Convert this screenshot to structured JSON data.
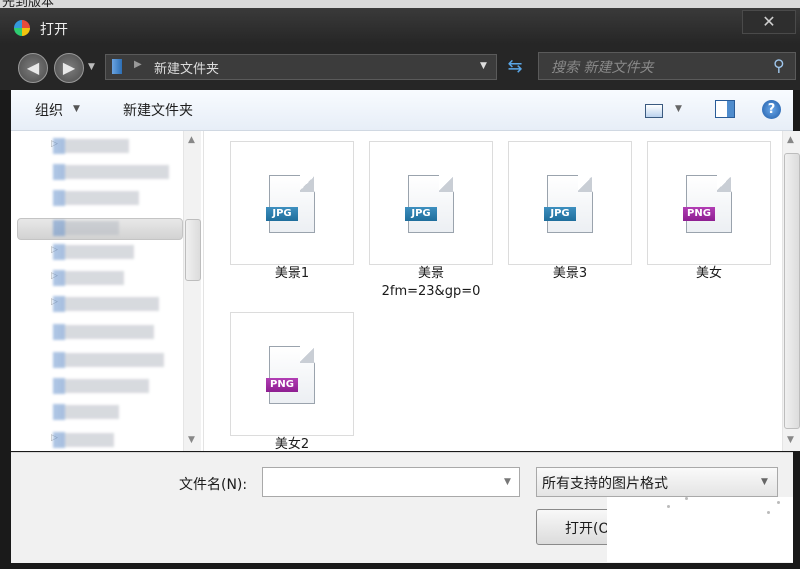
{
  "window": {
    "title": "打开",
    "close_glyph": "✕"
  },
  "nav": {
    "back_glyph": "◀",
    "forward_glyph": "▶",
    "address": {
      "path": "新建文件夹"
    },
    "search": {
      "placeholder": "搜索 新建文件夹"
    }
  },
  "toolbar": {
    "organize_label": "组织",
    "new_folder_label": "新建文件夹"
  },
  "help_glyph": "?",
  "files": [
    {
      "name": "美景1",
      "type": "JPG"
    },
    {
      "name": "美景\n2fm=23&gp=0",
      "type": "JPG"
    },
    {
      "name": "美景3",
      "type": "JPG"
    },
    {
      "name": "美女",
      "type": "PNG"
    },
    {
      "name": "美女2",
      "type": "PNG"
    }
  ],
  "bottom": {
    "filename_label": "文件名(N):",
    "filename_value": "",
    "filetype_selected": "所有支持的图片格式",
    "open_button_label": "打开(O"
  },
  "icons": [
    "app-icon",
    "back-icon",
    "forward-icon",
    "folder-icon",
    "refresh-icon",
    "search-icon",
    "view-icon",
    "preview-pane-icon",
    "help-icon",
    "jpg-file-icon",
    "png-file-icon"
  ]
}
